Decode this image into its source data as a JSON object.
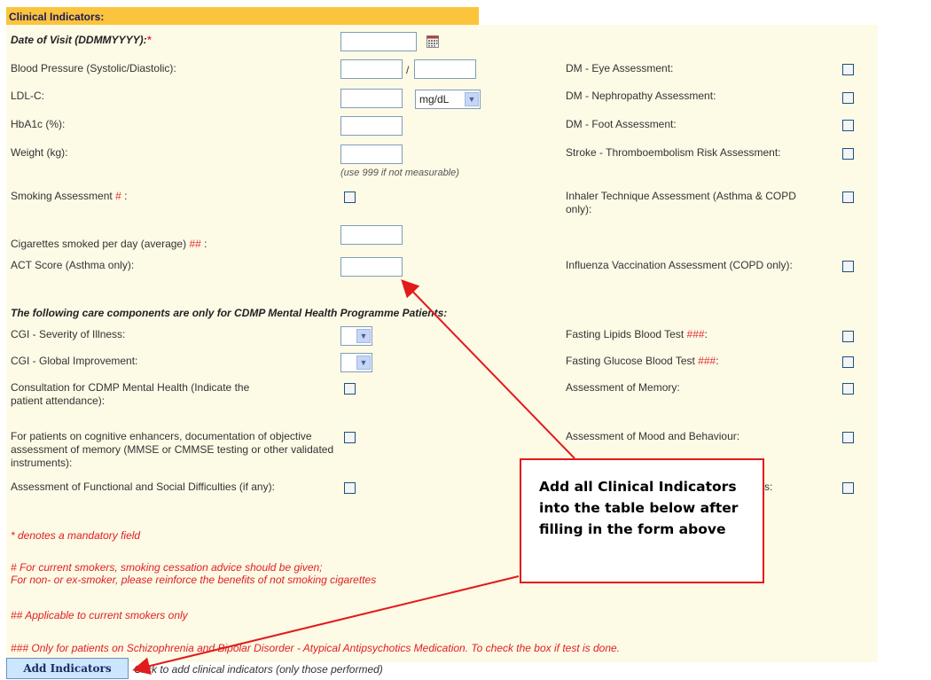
{
  "header": {
    "title": "Clinical Indicators:"
  },
  "left": {
    "date_label": "Date of Visit (DDMMYYYY):",
    "date_required": "*",
    "bp_label": "Blood Pressure (Systolic/Diastolic):",
    "bp_sep": "/",
    "ldl_label": "LDL-C:",
    "ldl_unit": "mg/dL",
    "hba1c_label": "HbA1c (%):",
    "weight_label": "Weight (kg):",
    "weight_hint": "(use 999 if not measurable)",
    "smoking_label": "Smoking Assessment",
    "smoking_mark": "#",
    "smoking_colon": " :",
    "cig_label": "Cigarettes smoked per day (average)",
    "cig_mark": "##",
    "cig_colon": " :",
    "act_label": "ACT Score (Asthma only):",
    "mh_heading": "The following care components are only for CDMP Mental Health Programme Patients:",
    "cgi_sev_label": "CGI - Severity of Illness:",
    "cgi_glob_label": "CGI - Global Improvement:",
    "consult_label": "Consultation for CDMP Mental Health (Indicate the patient attendance):",
    "cognitive_label": "For patients on cognitive enhancers, documentation of objective assessment of memory (MMSE or CMMSE testing or other validated instruments):",
    "functional_label": "Assessment of Functional and Social Difficulties (if any):"
  },
  "right": {
    "eye_label": "DM - Eye Assessment:",
    "nephro_label": "DM - Nephropathy Assessment:",
    "foot_label": "DM - Foot Assessment:",
    "stroke_label": "Stroke - Thromboembolism Risk Assessment:",
    "inhaler_label": "Inhaler Technique Assessment (Asthma & COPD only):",
    "influenza_label": "Influenza Vaccination Assessment (COPD only):",
    "lipids_label": "Fasting Lipids Blood Test",
    "lipids_mark": "###",
    "glucose_label": "Fasting Glucose Blood Test",
    "glucose_mark": "###",
    "memory_label": "Assessment of Memory:",
    "mood_label": "Assessment of Mood and Behaviour:",
    "hidden_tail": "s:"
  },
  "notes": {
    "mandatory": "* denotes a mandatory field",
    "smokers_1": "# For current smokers, smoking cessation advice should be given;",
    "smokers_2": "For non- or ex-smoker, please reinforce the benefits of not smoking cigarettes",
    "current_smokers": "## Applicable to current smokers only",
    "schizo": "### Only for patients on Schizophrenia and Bipolar Disorder - Atypical Antipsychotics Medication. To check the box if test is done."
  },
  "action": {
    "add_label": "Add Indicators",
    "add_hint": "Click to add clinical indicators (only those performed)"
  },
  "callout": {
    "text": "Add all Clinical Indicators into the table below after filling in the form above"
  },
  "colors": {
    "header": "#fcc43c",
    "panel": "#fdfae6",
    "note_red": "#e02020",
    "callout_border": "#e21b1b"
  }
}
